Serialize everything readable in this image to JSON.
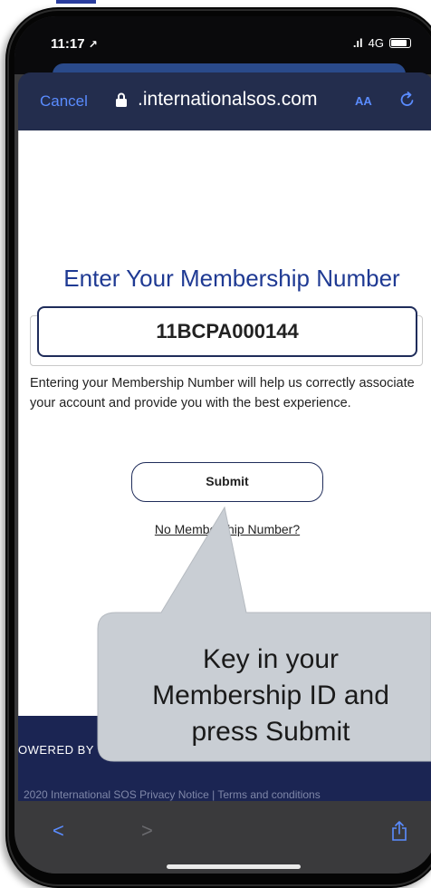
{
  "status_bar": {
    "time": "11:17",
    "location_glyph": "↗",
    "signal": ".ıl",
    "network": "4G"
  },
  "browser": {
    "cancel_label": "Cancel",
    "url": "internationalsos.com",
    "url_prefix": ".",
    "text_size_label": "AA"
  },
  "page": {
    "heading": "Enter Your Membership Number",
    "membership_value": "11BCPA000144",
    "description": "Entering your  Membership Number will help us correctly associate your account and  provide you with the best experience.",
    "submit_label": "Submit",
    "no_membership_link": "No Membership Number?"
  },
  "footer": {
    "powered_by": "OWERED BY",
    "legal": "2020 International SOS     Privacy Notice   |   Terms and conditions"
  },
  "toolbar": {
    "back_glyph": "<",
    "forward_glyph": ">"
  },
  "callout": {
    "line1": "Key in your",
    "line2": "Membership ID and",
    "line3": "press Submit"
  },
  "colors": {
    "heading": "#1f3a93",
    "browser_link": "#5a8cff",
    "footer_bg": "#1b2553",
    "callout_bg": "#c9ced4",
    "accent": "#2a3d9e"
  }
}
